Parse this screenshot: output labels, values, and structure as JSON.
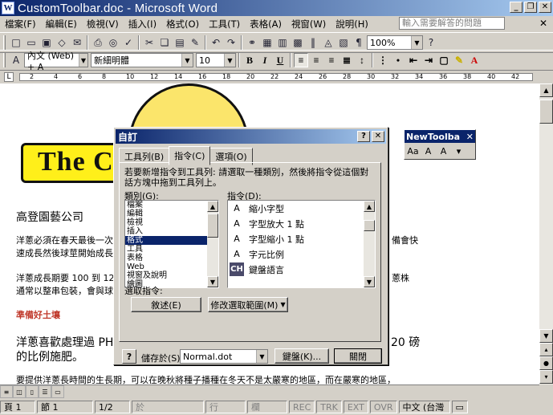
{
  "window": {
    "title": "CustomToolbar.doc - Microsoft Word",
    "app_icon": "W",
    "min": "_",
    "max": "❐",
    "close": "✕"
  },
  "menubar": {
    "items": [
      "檔案(F)",
      "編輯(E)",
      "檢視(V)",
      "插入(I)",
      "格式(O)",
      "工具(T)",
      "表格(A)",
      "視窗(W)",
      "說明(H)"
    ],
    "ask_placeholder": "輸入需要解答的問題",
    "close": "✕"
  },
  "toolbar": {
    "zoom": "100%"
  },
  "formatting": {
    "style": "內文 (Web) + A",
    "font": "新細明體",
    "size": "10"
  },
  "ruler": {
    "marks": [
      "2",
      "4",
      "6",
      "8",
      "10",
      "12",
      "14",
      "16",
      "18",
      "20",
      "22",
      "24",
      "26",
      "28",
      "30",
      "32",
      "34",
      "36",
      "38",
      "40",
      "42"
    ]
  },
  "document": {
    "logo_text": "The C",
    "company": "高登園藝公司",
    "para1a": "洋蔥必須在春天最後一次",
    "para1b": "備會快",
    "para1c": "速成長然後球莖開始成長",
    "para2a": "洋蔥成長期要 100 到 12",
    "para2b": "蔥株",
    "para2c": "通常以整串包裝，會與球",
    "heading": "準備好土壤",
    "para3a": "洋蔥喜歡處理過 PH",
    "para3b": "20 磅",
    "para3c": "的比例施肥。",
    "para4": "要提供洋蔥長時間的生長期，可以在晚秋將種子播種在冬天不是太嚴寒的地區，而在嚴寒的地區，"
  },
  "new_toolbar": {
    "title": "NewToolba",
    "close": "✕"
  },
  "dialog": {
    "title": "自訂",
    "help": "?",
    "close": "✕",
    "tabs": [
      "工具列(B)",
      "指令(C)",
      "選項(O)"
    ],
    "instruction": "若要新增指令到工具列: 請選取一種類別，然後將指令從這個對話方塊中拖到工具列上。",
    "categories_label": "類別(G):",
    "categories": [
      "檔案",
      "編輯",
      "檢視",
      "插入",
      "格式",
      "工具",
      "表格",
      "Web",
      "視窗及說明",
      "繪圖"
    ],
    "selected_category": 4,
    "commands_label": "指令(D):",
    "commands": [
      {
        "icon": "A",
        "label": "縮小字型"
      },
      {
        "icon": "A",
        "label": "字型放大 1 點"
      },
      {
        "icon": "A",
        "label": "字型縮小 1 點"
      },
      {
        "icon": "A",
        "label": "字元比例"
      },
      {
        "icon": "CH",
        "label": "鍵盤語言"
      }
    ],
    "selected_command_label": "選取指令:",
    "describe_button": "敘述(E)",
    "modify_button": "修改選取範圍(M)",
    "save_in_label": "儲存於(S):",
    "save_in_value": "Normal.dot",
    "keyboard_button": "鍵盤(K)...",
    "close_button": "關閉"
  },
  "statusbar": {
    "page": "頁 1",
    "section": "節 1",
    "pages": "1/2",
    "at": "於",
    "line": "行",
    "col": "欄",
    "rec": "REC",
    "trk": "TRK",
    "ext": "EXT",
    "ovr": "OVR",
    "lang": "中文 (台灣"
  }
}
